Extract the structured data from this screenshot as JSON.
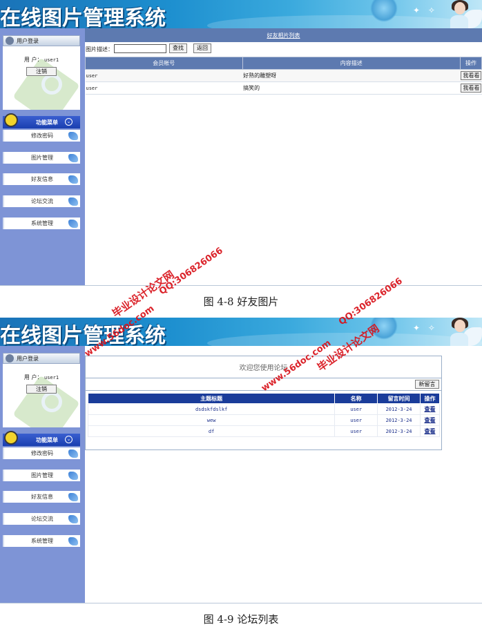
{
  "app": {
    "banner_title": "在线图片管理系统"
  },
  "sidebar": {
    "login_title": "用户登录",
    "user_label": "用 户：",
    "username": "user1",
    "logout_label": "注销",
    "menu_title": "功能菜单",
    "menu_items": [
      {
        "label": "修改密码"
      },
      {
        "label": "图片管理"
      },
      {
        "label": "好友信息"
      },
      {
        "label": "论坛交流"
      },
      {
        "label": "系统管理"
      }
    ]
  },
  "friend_photos": {
    "header": "好友相片列表",
    "search_label": "图片描述：",
    "search_value": "",
    "search_button": "查找",
    "back_button": "返回",
    "columns": [
      "会员帐号",
      "内容描述",
      "操作"
    ],
    "rows": [
      {
        "account": "user",
        "desc": "好熟的雕塑呀",
        "action": "我看看"
      },
      {
        "account": "user",
        "desc": "搞笑的",
        "action": "我看看"
      }
    ]
  },
  "forum": {
    "welcome": "欢迎您使用论坛",
    "new_message_button": "新留言",
    "columns": [
      "主题标题",
      "名称",
      "留言时间",
      "操作"
    ],
    "rows": [
      {
        "title": "dsdskfdslkf",
        "name": "user",
        "time": "2012-3-24",
        "action": "查看"
      },
      {
        "title": "wew",
        "name": "user",
        "time": "2012-3-24",
        "action": "查看"
      },
      {
        "title": "df",
        "name": "user",
        "time": "2012-3-24",
        "action": "查看"
      }
    ]
  },
  "captions": {
    "fig1": "图 4-8   好友图片",
    "fig2": "图 4-9  论坛列表"
  },
  "watermark": {
    "site": "www.56doc.com",
    "qq": "QQ:306826066",
    "name": "毕业设计论文网"
  }
}
